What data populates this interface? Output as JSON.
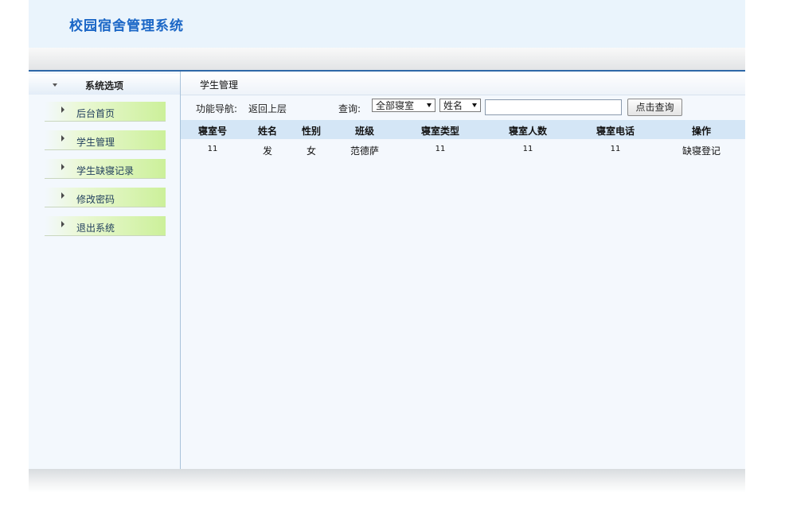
{
  "header": {
    "title": "校园宿舍管理系统"
  },
  "sidebar": {
    "heading": "系统选项",
    "items": [
      {
        "label": "后台首页"
      },
      {
        "label": "学生管理"
      },
      {
        "label": "学生缺寝记录"
      },
      {
        "label": "修改密码"
      },
      {
        "label": "退出系统"
      }
    ]
  },
  "main": {
    "tab_title": "学生管理",
    "nav_label": "功能导航:",
    "back_link": "返回上层",
    "query_label": "查询:",
    "dorm_filter": {
      "selected": "全部寝室"
    },
    "field_filter": {
      "selected": "姓名"
    },
    "search_value": "",
    "search_button": "点击查询",
    "table": {
      "headers": [
        "寝室号",
        "姓名",
        "性别",
        "班级",
        "寝室类型",
        "寝室人数",
        "寝室电话",
        "操作"
      ],
      "rows": [
        [
          "11",
          "发",
          "女",
          "范德萨",
          "11",
          "11",
          "11",
          "缺寝登记"
        ]
      ]
    }
  },
  "colors": {
    "title": "#1a66c6",
    "header_bg": "#eaf4fc",
    "menu_green": "#ccf09a",
    "table_header_bg": "#d4e6f6",
    "divider_blue": "#2e68a8"
  }
}
